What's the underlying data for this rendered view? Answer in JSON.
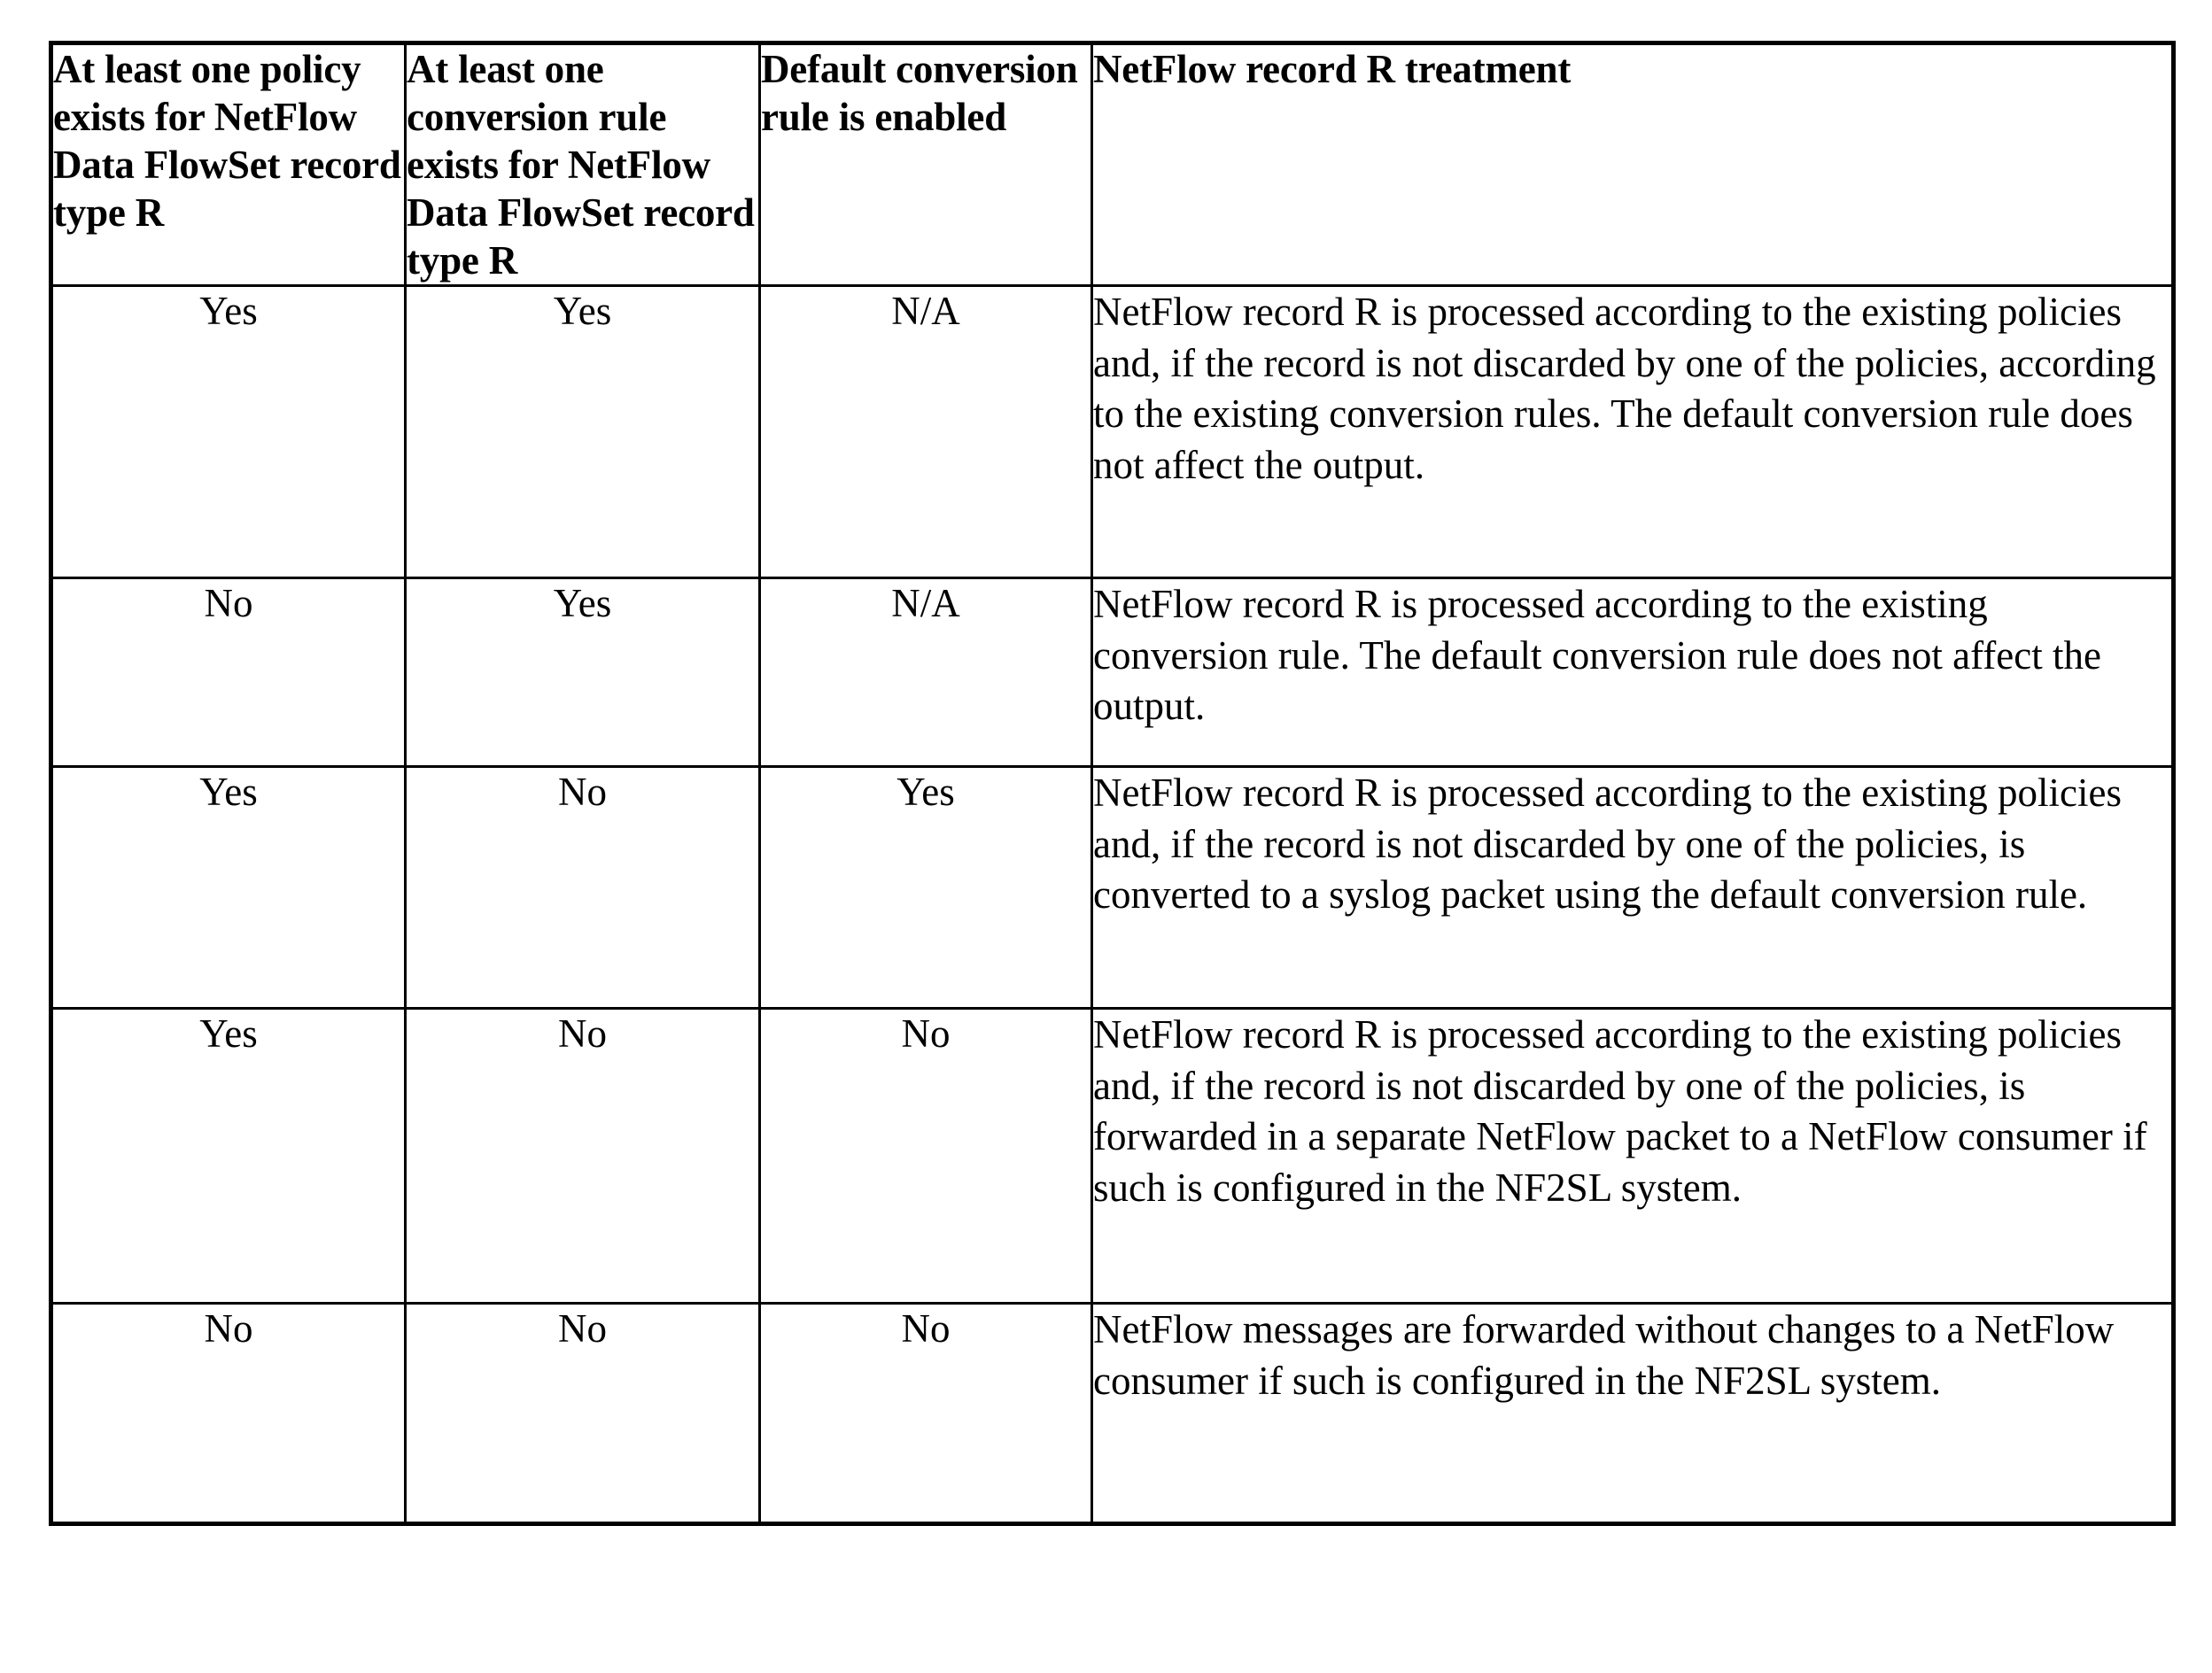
{
  "table": {
    "headers": [
      "At least one policy exists for NetFlow Data FlowSet record type R",
      "At least one conversion rule exists for NetFlow Data FlowSet record type R",
      "Default conversion rule is enabled",
      "NetFlow record R treatment"
    ],
    "rows": [
      {
        "policy_exists": "Yes",
        "conversion_rule_exists": "Yes",
        "default_rule_enabled": "N/A",
        "treatment": "NetFlow record R is processed according to the existing policies and, if the record is not discarded by one of the policies, according to the existing conversion rules. The default conversion rule does not affect the output."
      },
      {
        "policy_exists": "No",
        "conversion_rule_exists": "Yes",
        "default_rule_enabled": "N/A",
        "treatment": "NetFlow record R is processed according to the existing conversion rule. The default conversion rule does not affect the output."
      },
      {
        "policy_exists": "Yes",
        "conversion_rule_exists": "No",
        "default_rule_enabled": "Yes",
        "treatment": "NetFlow record R is processed according to the existing policies and, if the record is not discarded by one of the policies, is converted to a syslog packet using the default conversion rule."
      },
      {
        "policy_exists": "Yes",
        "conversion_rule_exists": "No",
        "default_rule_enabled": "No",
        "treatment": "NetFlow record R is processed according to the existing policies and, if the record is not discarded by one of the policies, is forwarded in a separate NetFlow packet to a NetFlow consumer if such is configured in the NF2SL system."
      },
      {
        "policy_exists": "No",
        "conversion_rule_exists": "No",
        "default_rule_enabled": "No",
        "treatment": "NetFlow messages are forwarded without changes to a NetFlow consumer if such is configured in the NF2SL system."
      }
    ]
  },
  "colors": {
    "border": "#000000",
    "text": "#000000",
    "background": "#ffffff"
  }
}
